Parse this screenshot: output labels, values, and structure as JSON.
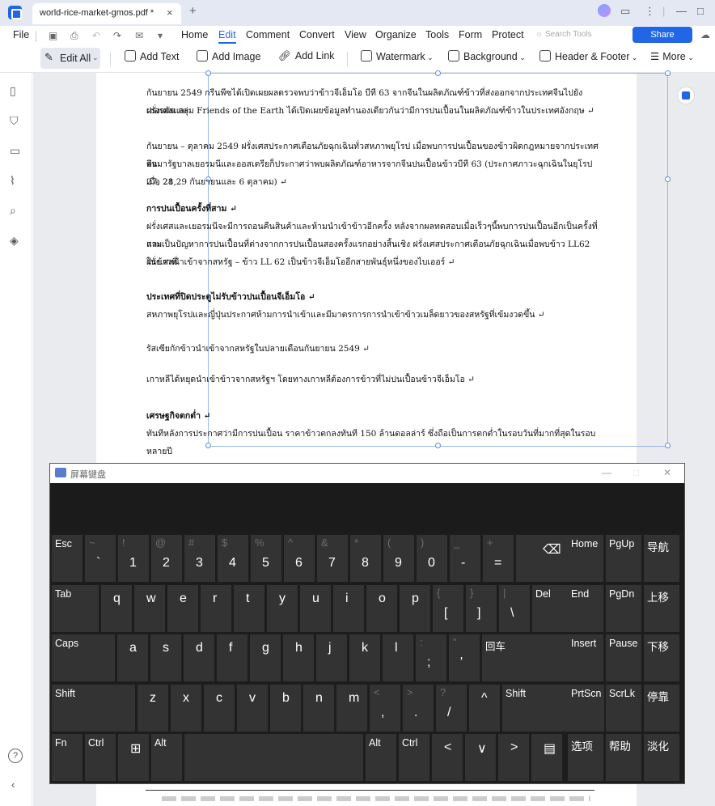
{
  "tabbar": {
    "doc_title": "world-rice-market-gmos.pdf *",
    "close_glyph": "×",
    "new_tab_glyph": "+"
  },
  "menu": {
    "file": "File",
    "items": [
      "Home",
      "Edit",
      "Comment",
      "Convert",
      "View",
      "Organize",
      "Tools",
      "Form",
      "Protect"
    ],
    "active": "Edit",
    "search_placeholder": "Search Tools",
    "share": "Share"
  },
  "edit_toolbar": {
    "edit_all": "Edit All",
    "add_text": "Add Text",
    "add_image": "Add Image",
    "add_link": "Add Link",
    "watermark": "Watermark",
    "background": "Background",
    "header_footer": "Header & Footer",
    "more": "More"
  },
  "document": {
    "paragraphs": [
      {
        "lines": [
          "กันยายน 2549 กรีนพีซได้เปิดเผยผลตรวจพบว่าข้าวจีเอ็มโอ บีที 63 จากจีนในผลิตภัณฑ์ข้าวที่ส่งออกจากประเทศจีนไปยังฝรั่งเศสและ",
          "เยอรมัน กลุ่ม Friends of the Earth ได้เปิดเผยข้อมูลทำนองเดียวกันว่ามีการปนเปื้อนในผลิตภัณฑ์ข้าวในประเทศอังกฤษ ↵"
        ]
      },
      {
        "lines": [
          "กันยายน – ตุลาคม 2549 ฝรั่งเศสประกาศเตือนภัยฉุกเฉินทั่วสหภาพยุโรป เมื่อพบการปนเปื้อนของข้าวผิดกฎหมายจากประเทศจีน",
          "ต่อมารัฐบาลเยอรมนีและออสเตรียก็ประกาศว่าพบผลิตภัณฑ์อาหารจากจีนปนเปื้อนข้าวบีที 63 (ประกาศภาวะฉุกเฉินในยุโรปเมื่อ 21,",
          "27, 28 29 กันยายนและ 6 ตุลาคม) ↵"
        ]
      },
      {
        "heading": "การปนเปื้อนครั้งที่สาม ↵",
        "lines": [
          "ฝรั่งเศสและเยอรมนีจะมีการถอนคืนสินค้าและห้ามนำเข้าข้าวอีกครั้ง หลังจากผลทดสอบเมื่อเร็วๆนี้พบการปนเปื้อนอีกเป็นครั้งที่สาม",
          "และเป็นปัญหาการปนเปื้อนที่ต่างจากการปนเปื้อนสองครั้งแรกอย่างสิ้นเชิง ฝรั่งเศสประกาศเตือนภัยฉุกเฉินเมื่อพบข้าว LL62 ในข้าวที่",
          "ฝรั่งเศสนำเข้าจากสหรัฐ – ข้าว LL 62 เป็นข้าวจีเอ็มโออีกสายพันธุ์หนึ่งของไบเออร์ ↵"
        ]
      },
      {
        "heading": "ประเทศที่ปิดประตูไม่รับข้าวปนเปื้อนจีเอ็มโอ ↵",
        "lines": [
          "สหภาพยุโรปและญี่ปุ่นประกาศห้ามการนำเข้าและมีมาตรการการนำเข้าข้าวเมล็ดยาวของสหรัฐที่เข้มงวดขึ้น ↵"
        ]
      },
      {
        "lines": [
          "รัสเซียกักข้าวนำเข้าจากสหรัฐในปลายเดือนกันยายน 2549 ↵"
        ]
      },
      {
        "lines": [
          "เกาหลีได้หยุดนำเข้าข้าวจากสหรัฐฯ โดยทางเกาหลีต้องการข้าวที่ไม่ปนเปื้อนข้าวจีเอ็มโอ ↵"
        ]
      },
      {
        "heading": "เศรษฐกิจตกต่ำ ↵",
        "lines": [
          "ทันทีหลังการประกาศว่ามีการปนเปื้อน ราคาข้าวตกลงทันที 150 ล้านดอลล่าร์ ซึ่งถือเป็นการตกต่ำในรอบวันที่มากที่สุดในรอบหลายปี"
        ]
      }
    ]
  },
  "osk": {
    "title": "屏幕键盘",
    "min": "—",
    "max": "□",
    "close": "✕",
    "row1": [
      {
        "main": "Esc"
      },
      {
        "shift": "~",
        "main": "`"
      },
      {
        "shift": "!",
        "main": "1"
      },
      {
        "shift": "@",
        "main": "2"
      },
      {
        "shift": "#",
        "main": "3"
      },
      {
        "shift": "$",
        "main": "4"
      },
      {
        "shift": "%",
        "main": "5"
      },
      {
        "shift": "^",
        "main": "6"
      },
      {
        "shift": "&",
        "main": "7"
      },
      {
        "shift": "*",
        "main": "8"
      },
      {
        "shift": "(",
        "main": "9"
      },
      {
        "shift": ")",
        "main": "0"
      },
      {
        "shift": "_",
        "main": "-"
      },
      {
        "shift": "+",
        "main": "="
      },
      {
        "main": "⌫"
      }
    ],
    "row2": [
      {
        "main": "Tab"
      },
      {
        "main": "q"
      },
      {
        "main": "w"
      },
      {
        "main": "e"
      },
      {
        "main": "r"
      },
      {
        "main": "t"
      },
      {
        "main": "y"
      },
      {
        "main": "u"
      },
      {
        "main": "i"
      },
      {
        "main": "o"
      },
      {
        "main": "p"
      },
      {
        "shift": "{",
        "main": "["
      },
      {
        "shift": "}",
        "main": "]"
      },
      {
        "shift": "|",
        "main": "\\"
      },
      {
        "main": "Del"
      }
    ],
    "row3": [
      {
        "main": "Caps"
      },
      {
        "main": "a"
      },
      {
        "main": "s"
      },
      {
        "main": "d"
      },
      {
        "main": "f"
      },
      {
        "main": "g"
      },
      {
        "main": "h"
      },
      {
        "main": "j"
      },
      {
        "main": "k"
      },
      {
        "main": "l"
      },
      {
        "shift": ":",
        "main": ";"
      },
      {
        "shift": "\"",
        "main": "'"
      },
      {
        "main": "回车"
      }
    ],
    "row4": [
      {
        "main": "Shift"
      },
      {
        "main": "z"
      },
      {
        "main": "x"
      },
      {
        "main": "c"
      },
      {
        "main": "v"
      },
      {
        "main": "b"
      },
      {
        "main": "n"
      },
      {
        "main": "m"
      },
      {
        "shift": "<",
        "main": ","
      },
      {
        "shift": ">",
        "main": "."
      },
      {
        "shift": "?",
        "main": "/"
      },
      {
        "main": "^"
      },
      {
        "main": "Shift"
      }
    ],
    "row5": [
      {
        "main": "Fn"
      },
      {
        "main": "Ctrl"
      },
      {
        "main": "⊞"
      },
      {
        "main": "Alt"
      },
      {
        "main": ""
      },
      {
        "main": "Alt"
      },
      {
        "main": "Ctrl"
      },
      {
        "main": "<"
      },
      {
        "main": "∨"
      },
      {
        "main": ">"
      },
      {
        "main": "▤"
      }
    ],
    "nav": [
      [
        "Home",
        "PgUp",
        "导航"
      ],
      [
        "End",
        "PgDn",
        "上移"
      ],
      [
        "Insert",
        "Pause",
        "下移"
      ],
      [
        "PrtScn",
        "ScrLk",
        "停靠"
      ],
      [
        "选项",
        "帮助",
        "淡化"
      ]
    ]
  }
}
